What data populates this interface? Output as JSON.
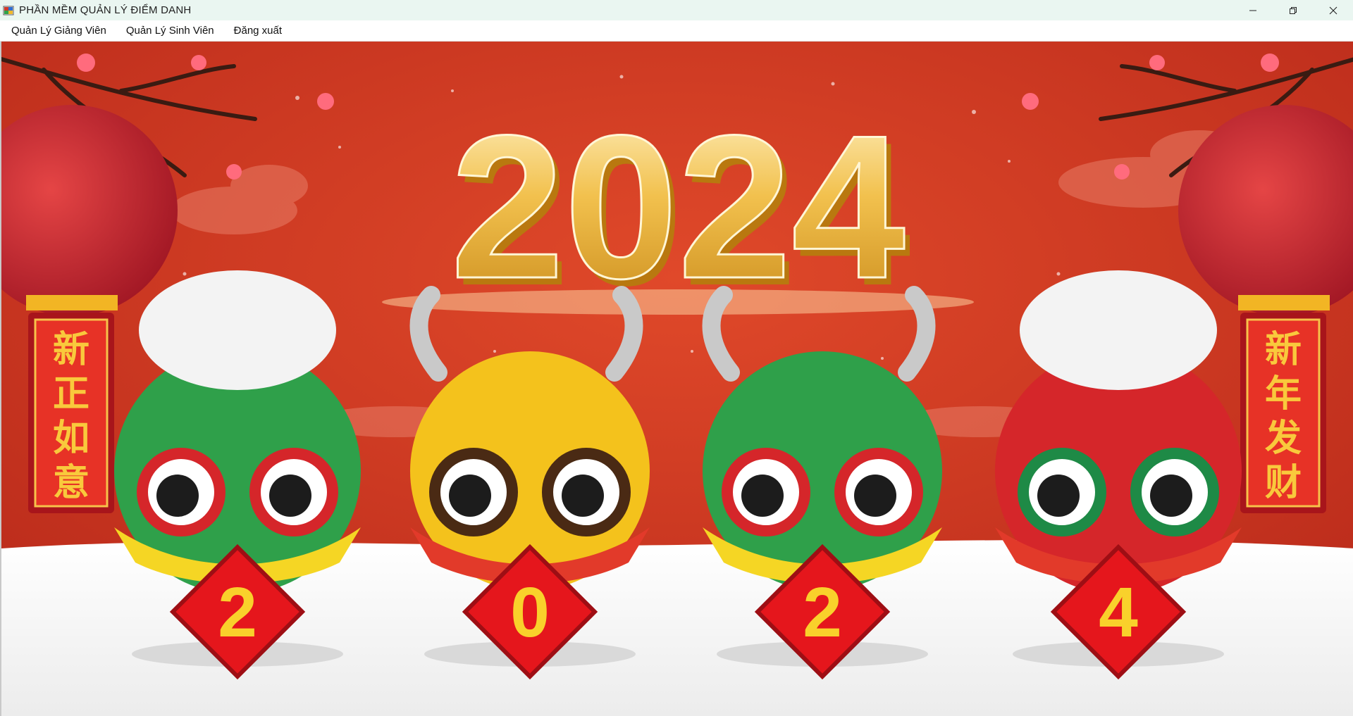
{
  "window": {
    "title": "PHẦN MỀM QUẢN LÝ ĐIỂM DANH",
    "controls": [
      "minimize",
      "restore",
      "close"
    ]
  },
  "menu": {
    "items": [
      {
        "label": "Quản Lý Giảng Viên"
      },
      {
        "label": "Quản Lý Sinh Viên"
      },
      {
        "label": "Đăng xuất"
      }
    ]
  },
  "banner": {
    "year": "2024",
    "left_couplet": [
      "新",
      "正",
      "如",
      "意"
    ],
    "right_couplet": [
      "新",
      "年",
      "发",
      "财"
    ],
    "signs": [
      "2",
      "0",
      "2",
      "4"
    ],
    "colors": {
      "background_red": "#c9301c",
      "gold": "#f2c14e",
      "snow": "#f7f7f7"
    }
  }
}
